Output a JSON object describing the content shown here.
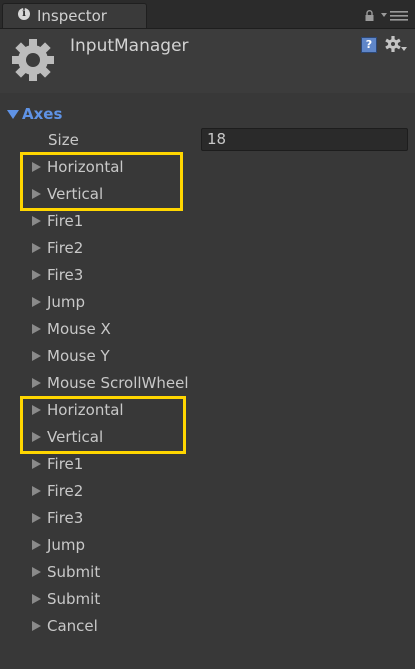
{
  "tab": {
    "title": "Inspector"
  },
  "header": {
    "title": "InputManager"
  },
  "axes": {
    "label": "Axes",
    "size_label": "Size",
    "size_value": "18",
    "items": [
      "Horizontal",
      "Vertical",
      "Fire1",
      "Fire2",
      "Fire3",
      "Jump",
      "Mouse X",
      "Mouse Y",
      "Mouse ScrollWheel",
      "Horizontal",
      "Vertical",
      "Fire1",
      "Fire2",
      "Fire3",
      "Jump",
      "Submit",
      "Submit",
      "Cancel"
    ]
  },
  "colors": {
    "highlight": "#ffd600",
    "foldout_accent": "#5f93e6"
  }
}
